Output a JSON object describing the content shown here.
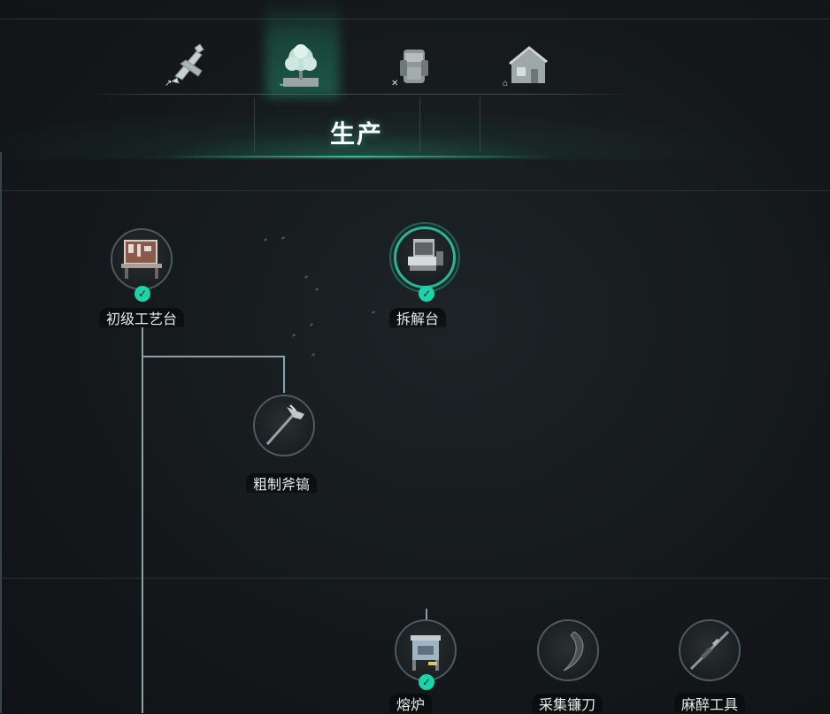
{
  "tabs": [
    {
      "name": "combat",
      "icon": "crossbow-icon",
      "badge": "↗"
    },
    {
      "name": "production",
      "icon": "tree-icon",
      "badge": "⌄",
      "active": true
    },
    {
      "name": "equipment",
      "icon": "backpack-icon",
      "badge": "✕"
    },
    {
      "name": "building",
      "icon": "house-icon",
      "badge": "⌂"
    }
  ],
  "section": {
    "title": "生产"
  },
  "nodes": {
    "workbench": {
      "label": "初级工艺台",
      "unlocked": true,
      "icon": "workbench-icon"
    },
    "disassembly": {
      "label": "拆解台",
      "unlocked": true,
      "icon": "disassembly-machine-icon"
    },
    "pickaxe": {
      "label": "粗制斧镐",
      "unlocked": false,
      "icon": "pickaxe-icon"
    },
    "furnace": {
      "label": "熔炉",
      "unlocked": true,
      "icon": "furnace-icon"
    },
    "sickle": {
      "label": "采集镰刀",
      "unlocked": false,
      "icon": "sickle-icon"
    },
    "tranq": {
      "label": "麻醉工具",
      "unlocked": false,
      "icon": "tranquilizer-rifle-icon"
    }
  },
  "colors": {
    "accent": "#1ed3a8",
    "connector": "#8aa3a6",
    "background": "#15191b"
  }
}
